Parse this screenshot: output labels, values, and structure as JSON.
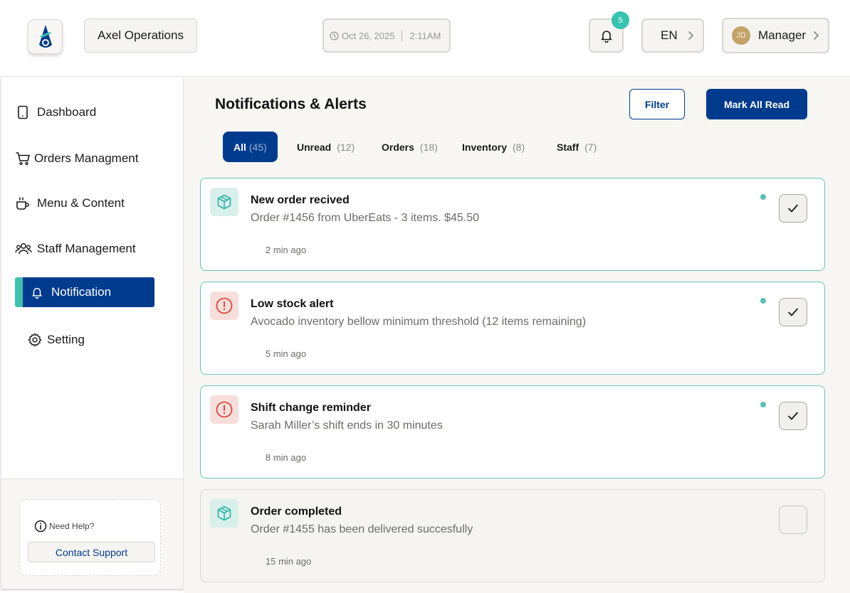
{
  "header": {
    "org_name": "Axel Operations",
    "date": "Oct 26, 2025",
    "time": "2:11AM",
    "notification_count": "5",
    "language": "EN",
    "user_initials": "JD",
    "user_role": "Manager"
  },
  "sidebar": {
    "items": [
      {
        "label": "Dashboard",
        "icon": "tablet-icon"
      },
      {
        "label": "Orders Managment",
        "icon": "cart-icon"
      },
      {
        "label": "Menu & Content",
        "icon": "coffee-cup-icon"
      },
      {
        "label": "Staff Management",
        "icon": "users-icon"
      },
      {
        "label": "Notification",
        "icon": "bell-icon",
        "active": true
      },
      {
        "label": "Setting",
        "icon": "gear-icon"
      }
    ],
    "help_title": "Need Help?",
    "support_label": "Contact Support"
  },
  "main": {
    "title": "Notifications & Alerts",
    "filter_label": "Filter",
    "mark_all_label": "Mark All Read",
    "tabs": [
      {
        "label": "All",
        "count": "(45)",
        "active": true
      },
      {
        "label": "Unread",
        "count": "(12)"
      },
      {
        "label": "Orders",
        "count": "(18)"
      },
      {
        "label": "Inventory",
        "count": "(8)"
      },
      {
        "label": "Staff",
        "count": "(7)"
      }
    ],
    "notifications": [
      {
        "title": "New order recived",
        "message": "Order #1456 from UberEats - 3 items. $45.50",
        "time": "2 min ago",
        "type": "order",
        "unread": true
      },
      {
        "title": "Low stock alert",
        "message": "Avocado inventory bellow minimum threshold (12 items remaining)",
        "time": "5 min ago",
        "type": "alert",
        "unread": true
      },
      {
        "title": "Shift change reminder",
        "message": "Sarah Miller’s shift ends in 30 minutes",
        "time": "8 min ago",
        "type": "alert",
        "unread": true
      },
      {
        "title": "Order completed",
        "message": "Order #1455 has been delivered succesfully",
        "time": "15 min ago",
        "type": "order",
        "unread": false
      }
    ]
  },
  "colors": {
    "brand_blue": "#003b8e",
    "accent_teal": "#3dc2b0",
    "alert_red": "#e0463c"
  }
}
